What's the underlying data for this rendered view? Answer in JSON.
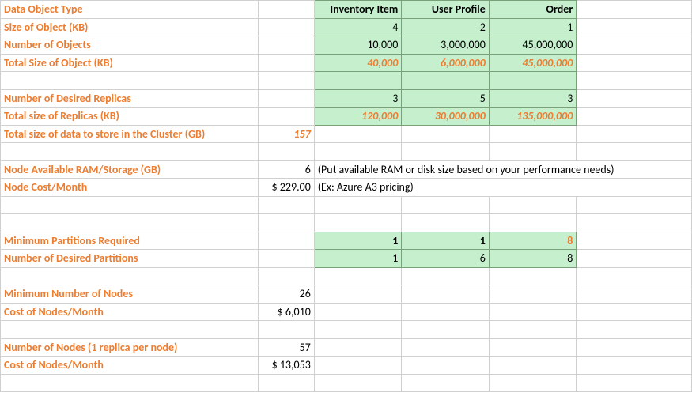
{
  "headers": {
    "col_c": "Inventory Item",
    "col_d": "User Profile",
    "col_e": "Order"
  },
  "labels": {
    "data_object_type": "Data Object Type",
    "size_of_object": "Size of Object (KB)",
    "number_of_objects": "Number of Objects",
    "total_size_of_object": "Total Size of Object (KB)",
    "number_desired_replicas": "Number of Desired Replicas",
    "total_size_replicas": "Total size of Replicas (KB)",
    "total_cluster_gb": "Total size of data to store in the Cluster (GB)",
    "node_ram": "Node Available RAM/Storage (GB)",
    "node_cost": "Node Cost/Month",
    "min_partitions_req": "Minimum Partitions Required",
    "num_desired_partitions": "Number of Desired Partitions",
    "min_nodes": "Minimum Number of Nodes",
    "cost_nodes_month": "Cost of Nodes/Month",
    "num_nodes_1rep": "Number of Nodes (1 replica per node)",
    "cost_nodes_month2": "Cost of Nodes/Month"
  },
  "inputs": {
    "size_kb": {
      "c": "4",
      "d": "2",
      "e": "1"
    },
    "num_objects": {
      "c": "10,000",
      "d": "3,000,000",
      "e": "45,000,000"
    },
    "replicas": {
      "c": "3",
      "d": "5",
      "e": "3"
    },
    "desired_part": {
      "c": "1",
      "d": "6",
      "e": "8"
    }
  },
  "calcs": {
    "total_size_kb": {
      "c": "40,000",
      "d": "6,000,000",
      "e": "45,000,000"
    },
    "replica_size": {
      "c": "120,000",
      "d": "30,000,000",
      "e": "135,000,000"
    },
    "min_partitions": {
      "c": "1",
      "d": "1",
      "e": "8"
    }
  },
  "totals": {
    "cluster_gb": "157",
    "node_ram_gb": "6",
    "node_cost_month": "$ 229.00",
    "min_nodes": "26",
    "cost_min_nodes": "$   6,010",
    "nodes_1rep": "57",
    "cost_nodes_1rep": "$ 13,053"
  },
  "hints": {
    "ram": "(Put available RAM or disk size based on your performance needs)",
    "cost": "(Ex: Azure A3 pricing)"
  },
  "chart_data": {
    "type": "table",
    "columns": [
      "Inventory Item",
      "User Profile",
      "Order"
    ],
    "rows": [
      {
        "metric": "Size of Object (KB)",
        "values": [
          4,
          2,
          1
        ]
      },
      {
        "metric": "Number of Objects",
        "values": [
          10000,
          3000000,
          45000000
        ]
      },
      {
        "metric": "Total Size of Object (KB)",
        "values": [
          40000,
          6000000,
          45000000
        ]
      },
      {
        "metric": "Number of Desired Replicas",
        "values": [
          3,
          5,
          3
        ]
      },
      {
        "metric": "Total size of Replicas (KB)",
        "values": [
          120000,
          30000000,
          135000000
        ]
      },
      {
        "metric": "Minimum Partitions Required",
        "values": [
          1,
          1,
          8
        ]
      },
      {
        "metric": "Number of Desired Partitions",
        "values": [
          1,
          6,
          8
        ]
      }
    ],
    "scalars": {
      "Total size of data to store in the Cluster (GB)": 157,
      "Node Available RAM/Storage (GB)": 6,
      "Node Cost/Month": 229.0,
      "Minimum Number of Nodes": 26,
      "Cost of Nodes/Month (min)": 6010,
      "Number of Nodes (1 replica per node)": 57,
      "Cost of Nodes/Month (1 replica)": 13053
    }
  }
}
